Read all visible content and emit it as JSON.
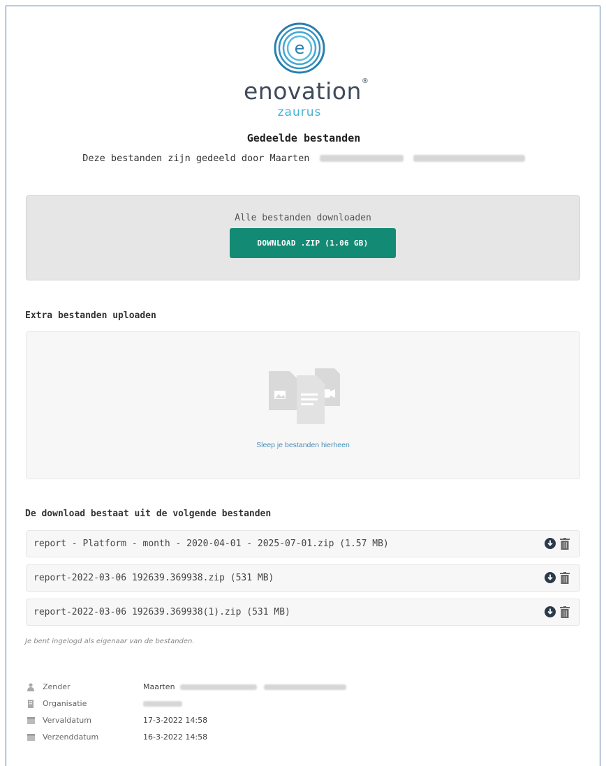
{
  "brand": {
    "name": "enovation",
    "sub": "zaurus"
  },
  "header": {
    "title": "Gedeelde bestanden",
    "subtitle": "Deze bestanden zijn gedeeld door Maarten"
  },
  "download_all": {
    "label": "Alle bestanden downloaden",
    "button": "DOWNLOAD .ZIP (1.06 GB)"
  },
  "upload": {
    "heading": "Extra bestanden uploaden",
    "hint": "Sleep je bestanden hierheen"
  },
  "files": {
    "heading": "De download bestaat uit de volgende bestanden",
    "items": [
      {
        "name": "report - Platform - month - 2020-04-01 - 2025-07-01.zip (1.57 MB)"
      },
      {
        "name": "report-2022-03-06 192639.369938.zip (531 MB)"
      },
      {
        "name": "report-2022-03-06 192639.369938(1).zip (531 MB)"
      }
    ],
    "note": "Je bent ingelogd als eigenaar van de bestanden."
  },
  "meta": {
    "sender_label": "Zender",
    "sender_value": "Maarten",
    "org_label": "Organisatie",
    "expiry_label": "Vervaldatum",
    "expiry_value": "17-3-2022 14:58",
    "sent_label": "Verzenddatum",
    "sent_value": "16-3-2022 14:58"
  },
  "colors": {
    "accent": "#138b74",
    "brand_text": "#3f4a5a",
    "brand_sub": "#45b3d4",
    "link": "#4a90b8"
  }
}
